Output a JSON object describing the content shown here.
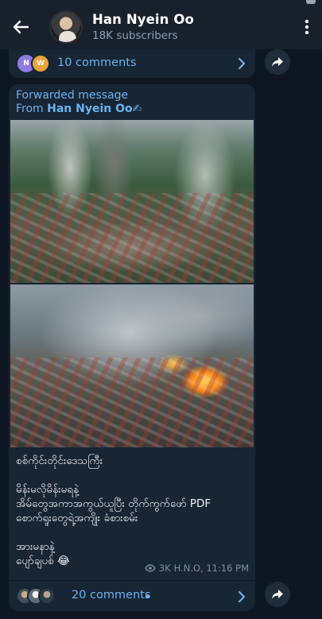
{
  "header": {
    "channel_name": "Han Nyein Oo",
    "subscribers": "18K subscribers"
  },
  "prev_post": {
    "avatars": [
      "N",
      "W"
    ],
    "comments_label": "10 comments"
  },
  "post": {
    "forwarded_label": "Forwarded message",
    "from_prefix": "From ",
    "from_name": "Han Nyein Oo",
    "from_emoji": "✍",
    "text_lines": [
      "စစ်ကိုင်းတိုင်းဒေသကြီး",
      "",
      "မိန်းမလိုမိန်းမရနဲ့",
      "အိမ်တွေအကာအကွယ်ယူပြီး တိုက်ကွက်ဖော် PDF",
      "စောက်ရူးတွေရဲ့အကျိုး ခံစားစမ်း",
      "",
      "အားမနာနဲ့",
      "ပျော်ချပစ် 😂"
    ],
    "views": "3K",
    "author_sign": "H.N.O, 11:16 PM",
    "comments_label": "20 comments"
  },
  "colors": {
    "background": "#0e1621",
    "header": "#17212b",
    "bubble": "#182533",
    "accent": "#6ab3f3",
    "meta": "#7f91a4"
  },
  "icons": [
    "back-arrow-icon",
    "more-vertical-icon",
    "share-icon",
    "chevron-right-icon",
    "eye-icon"
  ]
}
